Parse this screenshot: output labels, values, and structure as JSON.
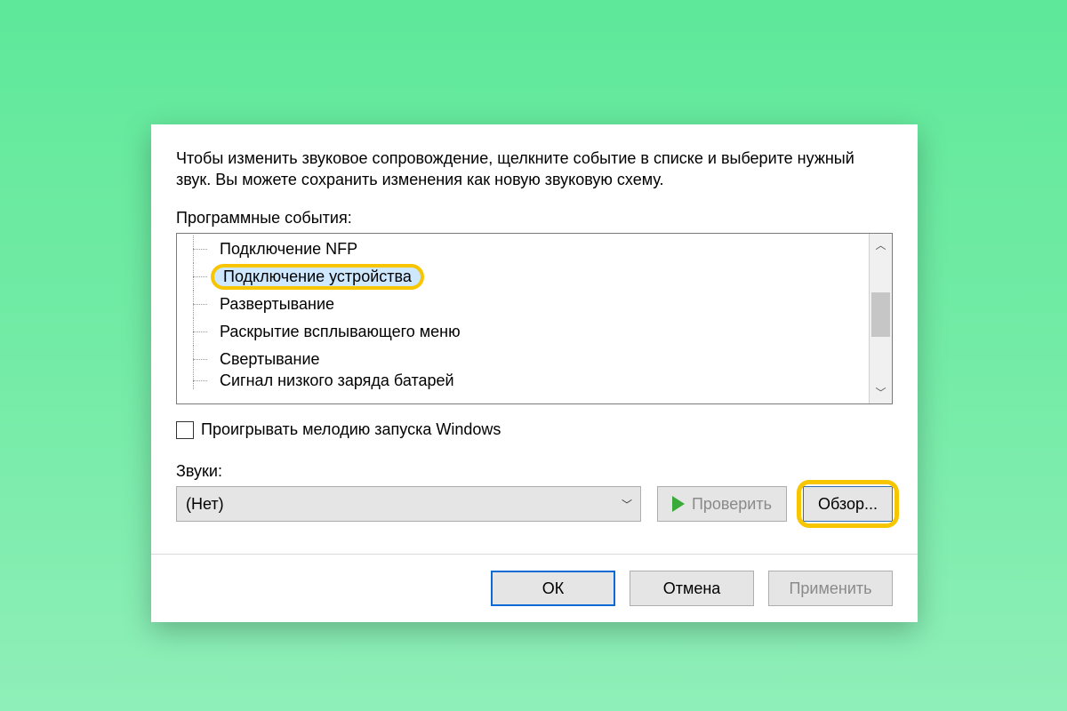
{
  "instruction": "Чтобы изменить звуковое сопровождение, щелкните событие в списке и выберите нужный звук. Вы можете сохранить изменения как новую звуковую схему.",
  "events_label": "Программные события:",
  "events": [
    {
      "label": "Подключение NFP",
      "selected": false,
      "highlighted": false
    },
    {
      "label": "Подключение устройства",
      "selected": true,
      "highlighted": true
    },
    {
      "label": "Развертывание",
      "selected": false,
      "highlighted": false
    },
    {
      "label": "Раскрытие всплывающего меню",
      "selected": false,
      "highlighted": false
    },
    {
      "label": "Свертывание",
      "selected": false,
      "highlighted": false
    },
    {
      "label": "Сигнал низкого заряда батарей",
      "selected": false,
      "highlighted": false
    }
  ],
  "checkbox_label": "Проигрывать мелодию запуска Windows",
  "checkbox_checked": false,
  "sounds_label": "Звуки:",
  "combo_value": "(Нет)",
  "test_button": "Проверить",
  "browse_button": "Обзор...",
  "browse_highlighted": true,
  "footer": {
    "ok": "ОК",
    "cancel": "Отмена",
    "apply": "Применить"
  }
}
